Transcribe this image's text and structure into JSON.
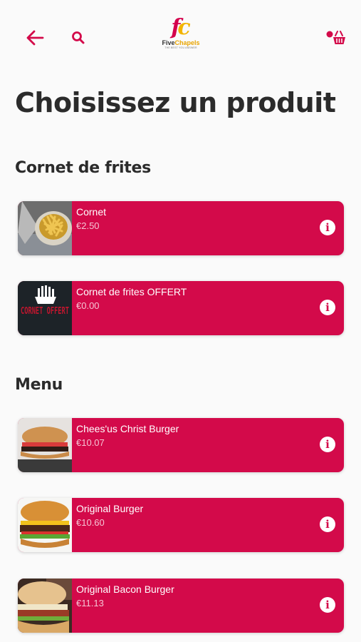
{
  "header": {
    "back_icon": "arrow-left-icon",
    "search_icon": "search-icon",
    "cart_icon": "basket-icon",
    "logo": {
      "letter_f": "f",
      "letter_c": "c",
      "name_part1": "Five",
      "name_part2": "Chapels",
      "tagline": "THE BEST YOU ANSWER"
    }
  },
  "page_title": "Choisissez un produit",
  "colors": {
    "accent": "#d30a4a",
    "text": "#2b2b2b",
    "background": "#fafafa"
  },
  "sections": [
    {
      "title": "Cornet de frites",
      "items": [
        {
          "name": "Cornet",
          "price": "€2.50"
        },
        {
          "name": "Cornet de frites OFFERT",
          "price": "€0.00",
          "thumb_text": "CORNET OFFERT"
        }
      ]
    },
    {
      "title": "Menu",
      "items": [
        {
          "name": "Chees'us Christ Burger",
          "price": "€10.07"
        },
        {
          "name": "Original Burger",
          "price": "€10.60"
        },
        {
          "name": "Original Bacon Burger",
          "price": "€11.13"
        }
      ]
    }
  ]
}
